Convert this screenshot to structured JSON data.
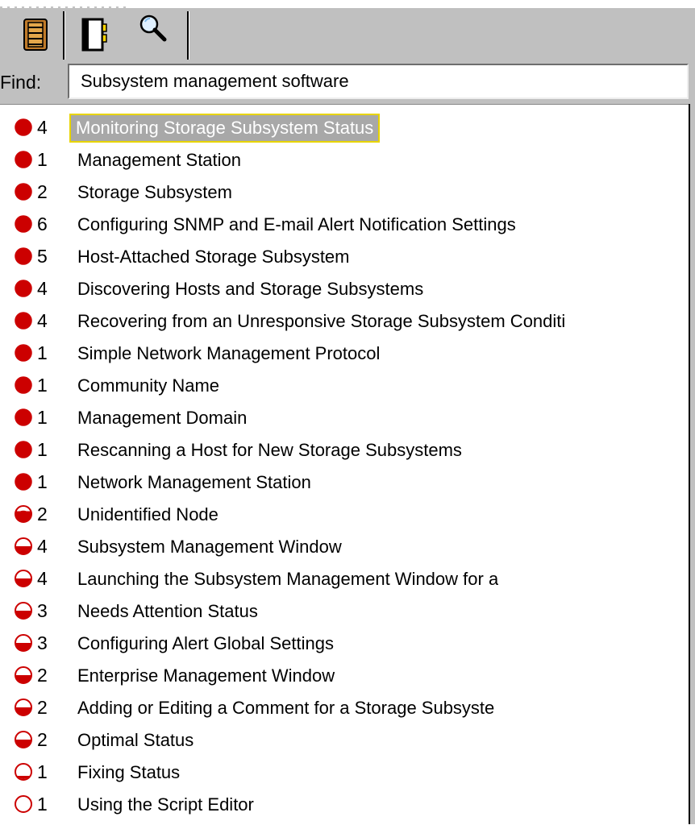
{
  "toolbar": {
    "icons": [
      "book-icon",
      "notebook-icon",
      "magnifier-icon"
    ]
  },
  "find": {
    "label": "Find:",
    "value": "Subsystem management software"
  },
  "results": [
    {
      "relevance": "full",
      "count": "4",
      "title": "Monitoring Storage Subsystem Status",
      "selected": true
    },
    {
      "relevance": "full",
      "count": "1",
      "title": "Management Station"
    },
    {
      "relevance": "full",
      "count": "2",
      "title": "Storage Subsystem"
    },
    {
      "relevance": "full",
      "count": "6",
      "title": "Configuring SNMP and E-mail Alert Notification Settings"
    },
    {
      "relevance": "full",
      "count": "5",
      "title": "Host-Attached Storage Subsystem"
    },
    {
      "relevance": "full",
      "count": "4",
      "title": "Discovering Hosts and Storage Subsystems"
    },
    {
      "relevance": "full",
      "count": "4",
      "title": "Recovering from an Unresponsive Storage Subsystem Conditi"
    },
    {
      "relevance": "full",
      "count": "1",
      "title": "Simple Network Management Protocol"
    },
    {
      "relevance": "full",
      "count": "1",
      "title": "Community Name"
    },
    {
      "relevance": "full",
      "count": "1",
      "title": "Management Domain"
    },
    {
      "relevance": "full",
      "count": "1",
      "title": "Rescanning a Host for New Storage Subsystems"
    },
    {
      "relevance": "full",
      "count": "1",
      "title": "Network Management Station"
    },
    {
      "relevance": "mostly",
      "count": "2",
      "title": "Unidentified Node"
    },
    {
      "relevance": "half",
      "count": "4",
      "title": "Subsystem Management Window"
    },
    {
      "relevance": "half",
      "count": "4",
      "title": "Launching the Subsystem Management Window for a"
    },
    {
      "relevance": "half",
      "count": "3",
      "title": "Needs Attention Status"
    },
    {
      "relevance": "half",
      "count": "3",
      "title": "Configuring Alert Global Settings"
    },
    {
      "relevance": "half",
      "count": "2",
      "title": "Enterprise Management Window"
    },
    {
      "relevance": "half",
      "count": "2",
      "title": "Adding or Editing a Comment for a Storage Subsyste"
    },
    {
      "relevance": "half",
      "count": "2",
      "title": "Optimal Status"
    },
    {
      "relevance": "low",
      "count": "1",
      "title": "Fixing Status"
    },
    {
      "relevance": "empty",
      "count": "1",
      "title": "Using the Script Editor"
    }
  ],
  "colors": {
    "toolbar": "#c0c0c0",
    "relevance_red": "#cc0000",
    "selection_bg": "#a8a8a8",
    "selection_border": "#e8d400"
  }
}
